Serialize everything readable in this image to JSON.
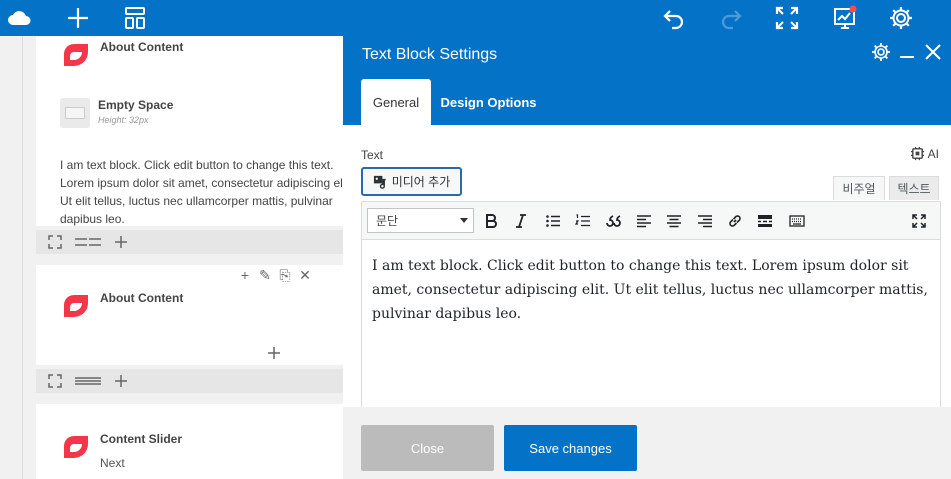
{
  "colors": {
    "brand": "#0473c7",
    "logo_red": "#f3364a",
    "notify_dot": "#ff4d4d"
  },
  "topbar": {
    "icons": [
      "cloud-logo-icon",
      "plus-icon",
      "layout-icon",
      "undo-icon",
      "redo-icon",
      "fullscreen-icon",
      "chart-icon",
      "gear-icon"
    ]
  },
  "canvas": {
    "block1": {
      "element1": {
        "title": "About Content"
      },
      "element2": {
        "title": "Empty Space",
        "subtitle": "Height: 32px"
      },
      "text": "I am text block. Click edit button to change this text. Lorem ipsum dolor sit amet, consectetur adipiscing elit. Ut elit tellus, luctus nec ullamcorper mattis, pulvinar dapibus leo."
    },
    "block2": {
      "element1": {
        "title": "About Content"
      }
    },
    "block3": {
      "element1": {
        "title": "Content Slider"
      },
      "next_label": "Next"
    }
  },
  "panel": {
    "title": "Text Block Settings",
    "tabs": [
      {
        "label": "General",
        "active": true
      },
      {
        "label": "Design Options",
        "active": false
      }
    ],
    "field_label": "Text",
    "ai_label": "AI",
    "media_button": "미디어 추가",
    "editor_tabs": {
      "visual": "비주얼",
      "text": "텍스트"
    },
    "format_select": "문단",
    "toolbar_icons": [
      "bold-icon",
      "italic-icon",
      "bullet-list-icon",
      "numbered-list-icon",
      "blockquote-icon",
      "align-left-icon",
      "align-center-icon",
      "align-right-icon",
      "link-icon",
      "read-more-icon",
      "toolbar-toggle-icon",
      "expand-icon"
    ],
    "content": "I am text block. Click edit button to change this text. Lorem ipsum dolor sit amet, consectetur adipiscing elit. Ut elit tellus, luctus nec ullamcorper mattis, pulvinar dapibus leo.",
    "footer": {
      "close": "Close",
      "save": "Save changes"
    }
  }
}
